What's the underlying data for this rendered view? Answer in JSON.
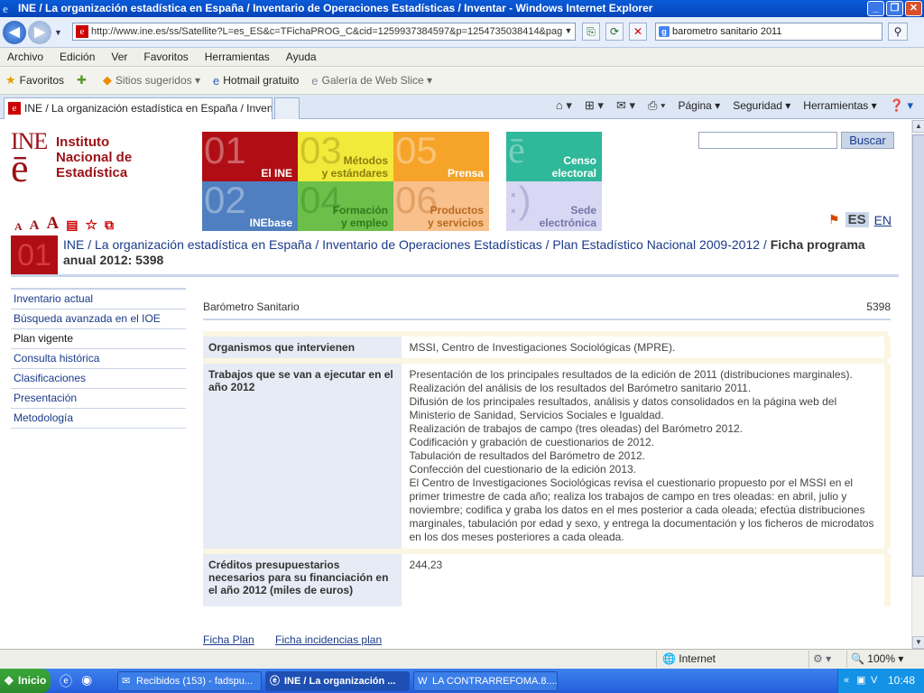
{
  "window": {
    "title": "INE / La organización estadística en España / Inventario de Operaciones Estadísticas / Inventar - Windows Internet Explorer"
  },
  "address": {
    "url": "http://www.ine.es/ss/Satellite?L=es_ES&c=TFichaPROG_C&cid=1259937384597&p=1254735038414&pag",
    "search": "barometro sanitario 2011"
  },
  "menu": [
    "Archivo",
    "Edición",
    "Ver",
    "Favoritos",
    "Herramientas",
    "Ayuda"
  ],
  "favbar": {
    "favoritos": "Favoritos",
    "sugeridos": "Sitios sugeridos",
    "hotmail": "Hotmail gratuito",
    "galeria": "Galería de Web Slice"
  },
  "tab": {
    "title": "INE / La organización estadística en España / Inventa..."
  },
  "cmdbar": {
    "pagina": "Página",
    "seguridad": "Seguridad",
    "herramientas": "Herramientas"
  },
  "site": {
    "logo": {
      "mark": "INE",
      "line1": "Instituto",
      "line2": "Nacional de",
      "line3": "Estadística"
    },
    "search_button": "Buscar",
    "lang_es": "ES",
    "lang_en": "EN",
    "text_sizes": [
      "A",
      "A",
      "A"
    ],
    "tiles": [
      {
        "num": "01",
        "label1": "El INE",
        "label2": ""
      },
      {
        "num": "03",
        "label1": "Métodos",
        "label2": "y estándares"
      },
      {
        "num": "05",
        "label1": "Prensa",
        "label2": ""
      },
      {
        "num": "",
        "label1": "Censo",
        "label2": "electoral"
      },
      {
        "num": "02",
        "label1": "INEbase",
        "label2": ""
      },
      {
        "num": "04",
        "label1": "Formación",
        "label2": "y empleo"
      },
      {
        "num": "06",
        "label1": "Productos",
        "label2": "y servicios"
      },
      {
        "num": ":)",
        "label1": "Sede",
        "label2": "electrónica"
      }
    ],
    "tile_colors": [
      "#b00d14",
      "#f2e82c",
      "#f6a32a",
      "#2fb89a",
      "#4f7fc0",
      "#6cc04a",
      "#f6b87a",
      "#c9c9f0"
    ],
    "breadcrumb": {
      "num": "01",
      "path": "INE / La organización estadística en España / Inventario de Operaciones Estadísticas / Plan Estadístico Nacional 2009-2012 / ",
      "current": "Ficha programa anual 2012: 5398"
    },
    "sidenav": [
      "Inventario actual",
      "Búsqueda avanzada en el IOE",
      "Plan vigente",
      "Consulta histórica",
      "Clasificaciones",
      "Presentación",
      "Metodología"
    ],
    "record": {
      "title": "Barómetro Sanitario",
      "code": "5398",
      "rows": [
        {
          "label": "Organismos que intervienen",
          "value": "MSSI, Centro de Investigaciones Sociológicas (MPRE)."
        },
        {
          "label": "Trabajos que se van a ejecutar en el año 2012",
          "value": "Presentación de los principales resultados de la edición de 2011 (distribuciones marginales).\nRealización del análisis de los resultados del Barómetro sanitario 2011.\nDifusión de los principales resultados, análisis y datos consolidados en la página web del Ministerio de Sanidad, Servicios Sociales e Igualdad.\nRealización de trabajos de campo (tres oleadas) del Barómetro 2012.\nCodificación y grabación de cuestionarios de 2012.\nTabulación de resultados del Barómetro de 2012.\nConfección del cuestionario de la edición 2013.\nEl Centro de Investigaciones Sociológicas revisa el cuestionario propuesto por el MSSI en el primer trimestre de cada año; realiza los trabajos de campo en tres oleadas: en abril, julio y noviembre; codifica y graba los datos en el mes posterior a cada oleada; efectúa distribuciones marginales, tabulación por edad y sexo, y entrega la documentación y los ficheros de microdatos en los dos meses posteriores a cada oleada."
        },
        {
          "label": "Créditos presupuestarios necesarios para su financiación en el año 2012 (miles de euros)",
          "value": "244,23"
        }
      ],
      "link1": "Ficha Plan",
      "link2": "Ficha incidencias plan"
    }
  },
  "status": {
    "zone": "Internet",
    "zoom": "100%"
  },
  "taskbar": {
    "start": "Inicio",
    "task1": "Recibidos (153) - fadspu...",
    "task2": "INE / La organización ...",
    "task3": "LA CONTRARREFOMA.8....",
    "time": "10:48"
  }
}
